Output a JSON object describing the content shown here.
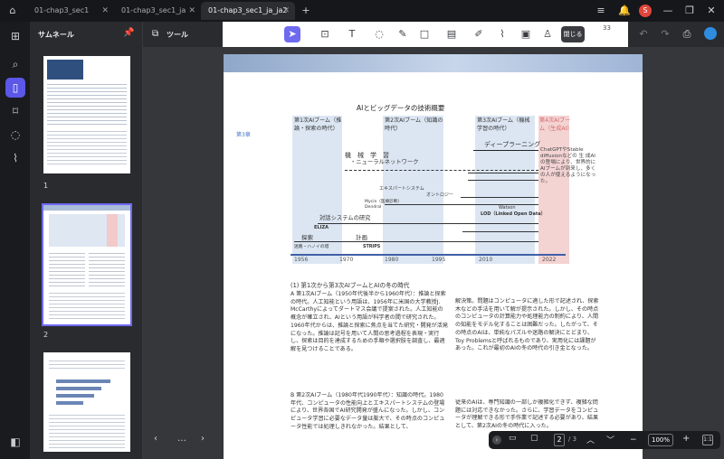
{
  "window": {
    "tabs": [
      {
        "label": "01-chap3_sec1"
      },
      {
        "label": "01-chap3_sec1_ja"
      },
      {
        "label": "01-chap3_sec1_ja_ja2"
      }
    ],
    "avatar_letter": "S"
  },
  "sidebar": {
    "title": "サムネール",
    "tools_label": "ツール"
  },
  "thumbnails": [
    {
      "num": "1"
    },
    {
      "num": "2"
    }
  ],
  "toolbar": {
    "close_label": "閉じる",
    "page_hint": "33"
  },
  "pagenav": {
    "current": "2",
    "total": "/ 3",
    "zoom": "100%"
  },
  "document": {
    "chapter_tag": "第3章",
    "figure_title": "AIとビッグデータの技術概要",
    "booms": [
      {
        "label": "第1次AIブーム（推論・探索の時代）"
      },
      {
        "label": "第2次AIブーム（知識の時代）"
      },
      {
        "label": "第3次AIブーム（機械学習の時代）"
      },
      {
        "label": "第4次AIブーム（生成AI）"
      }
    ],
    "fig_labels": {
      "ml": "機　械　学　習",
      "nn": "・ニューラルネットワーク",
      "dl": "ディープラーニング",
      "gen": "ChatGPTやStable diffusionなどの 生 成AIの登場により、世界的にAIブームが到来し、多くの人が使えるようになった。",
      "expert": "エキスパートシステム",
      "onto": "オントロジー",
      "mycin": "Mycin（医療診断）Dendral",
      "watson": "Watson",
      "lod": "LOD（Linked Open Data）",
      "dialog": "対話システムの研究",
      "eliza": "ELIZA",
      "search": "探索",
      "plan": "計画",
      "hanoi": "迷路・ハノイの塔",
      "strips": "STRIPS"
    },
    "years": [
      "1956",
      "1970",
      "1980",
      "1995",
      "2010",
      "2022"
    ],
    "sec1_heading": "(1) 第1次から第3次AIブームとAIの冬の時代",
    "sec1_left": "A 第1次AIブーム（1950年代後半から1960年代）：推論と探索の時代。人工知能という用語は、1956年に米国の大学教授J. McCarthyによってダートマス会議で提案された。人工知能の概念が確立され、AIという用語が科学者の間で研究された。1960年代からは、推論と探索に焦点を当てた研究・開発が活発になった。推論は記号を用いて人間の思考過程を表現・実行し、探索は目的を達成するための手順や選択肢を調査し、最適解を見つけることである。",
    "sec1_right": "解決策。問題はコンピュータに適した形で記述され、探索木などの手法を用いて解が提示された。しかし、その時点のコンピュータの計算能力や処理能力の制約により、人間の知能をモデル化することは困難だった。したがって、その時点のAIは、単純なパズルや迷路の解決にとどまり、Toy Problemsと呼ばれるものであり、実用化には課題があった。これが最初のAIの冬の時代の引き金となった。",
    "sec2_left": "B 第2次AIブーム（1980年代1990年代）：知識の時代。1980年代、コンピュータの性能向上とエキスパートシステムの登場により、世界各国でAI研究開発が盛んになった。しかし、コンピュータ学習に必要なデータ量は膨大で、その時点のコンピュータ性能では処理しきれなかった。結果として、",
    "sec2_right": "従来のAIは、専門知識の一部しか複雑化できず、複雑な問題には対応できなかった。さらに、学習データをコンピュータが理解できる形で手作業で記述する必要があり、結果として、第2次AIの冬の時代に入った。"
  }
}
